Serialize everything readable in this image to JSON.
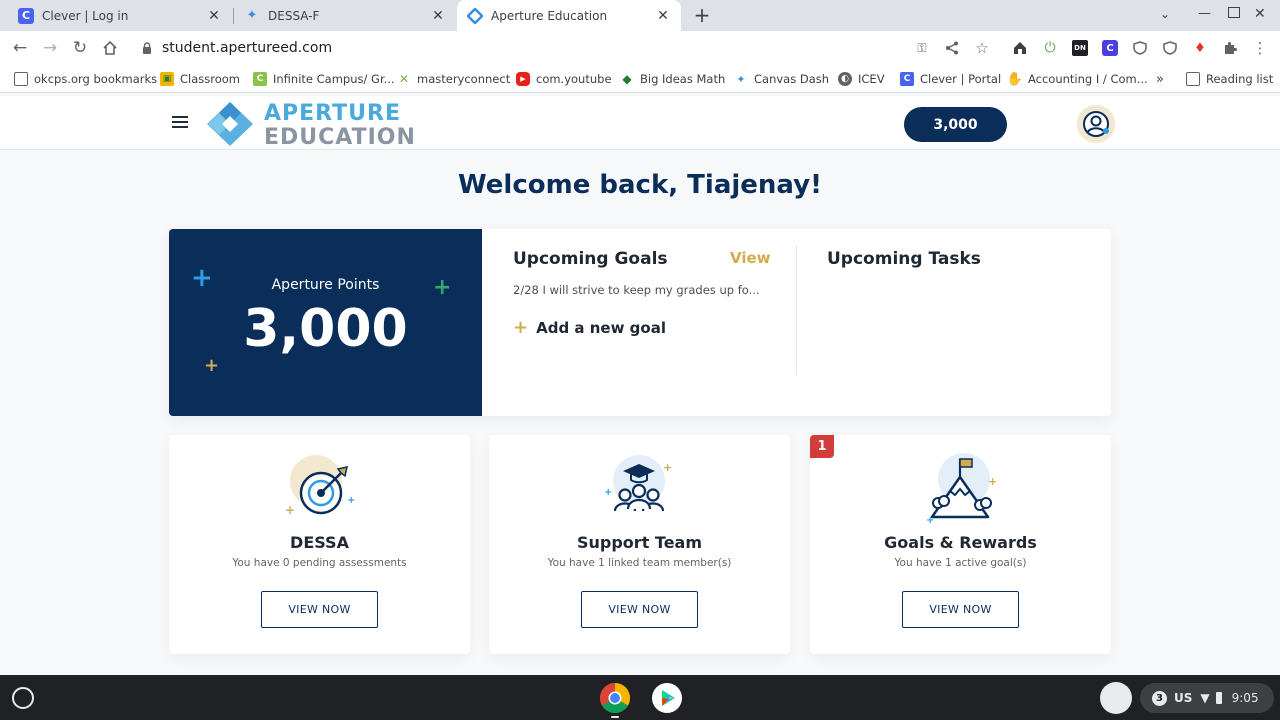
{
  "browser": {
    "tabs": [
      {
        "title": "Clever | Log in",
        "icon": "clever-icon",
        "color": "#4a62f2"
      },
      {
        "title": "DESSA-F",
        "icon": "aperture-icon",
        "color": "#3a8de0"
      },
      {
        "title": "Aperture Education",
        "icon": "aperture-icon",
        "color": "#3a8de0"
      }
    ],
    "new_tab": "+",
    "url": "student.apertureed.com",
    "bookmarks": [
      {
        "label": "okcps.org bookmarks"
      },
      {
        "label": "Classroom"
      },
      {
        "label": "Infinite Campus/ Gr..."
      },
      {
        "label": "masteryconnect"
      },
      {
        "label": "com.youtube"
      },
      {
        "label": "Big Ideas Math"
      },
      {
        "label": "Canvas Dash"
      },
      {
        "label": "ICEV"
      },
      {
        "label": "Clever | Portal"
      },
      {
        "label": "Accounting I / Com..."
      },
      {
        "label": "Reading list"
      }
    ],
    "overflow": "»"
  },
  "app": {
    "logo_line1": "APERTURE",
    "logo_line2": "EDUCATION",
    "points_pill": "3,000",
    "welcome": "Welcome back, Tiajenay!",
    "points": {
      "label": "Aperture Points",
      "value": "3,000"
    },
    "goals": {
      "title": "Upcoming Goals",
      "view": "View",
      "item": "2/28 I will strive to keep my grades up fo...",
      "add": "Add a new goal"
    },
    "tasks": {
      "title": "Upcoming Tasks"
    },
    "cards": [
      {
        "title": "DESSA",
        "subtitle": "You have 0 pending assessments",
        "button": "VIEW NOW"
      },
      {
        "title": "Support Team",
        "subtitle": "You have 1 linked team member(s)",
        "button": "VIEW NOW"
      },
      {
        "title": "Goals & Rewards",
        "subtitle": "You have 1 active goal(s)",
        "button": "VIEW NOW",
        "badge": "1"
      }
    ],
    "colors": {
      "navy": "#0a2d5a",
      "gold": "#d4a94f",
      "blue": "#2e9be6",
      "green": "#2ea86b"
    }
  },
  "shelf": {
    "notifications": "3",
    "locale": "US",
    "time": "9:05"
  }
}
